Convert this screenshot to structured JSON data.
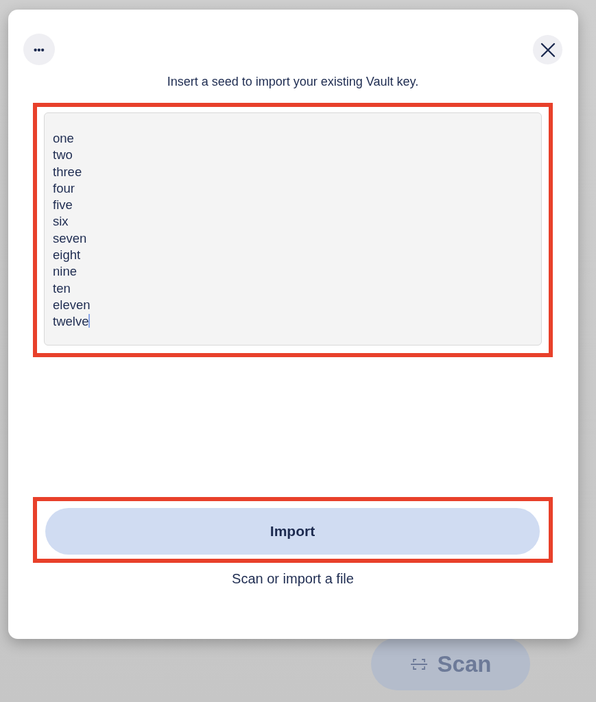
{
  "background": {
    "scan_button": {
      "label": "Scan",
      "disabled": true
    }
  },
  "dialog": {
    "more_button": {
      "label": "•••"
    },
    "instruction": "Insert a seed to import your existing Vault key.",
    "seed_field": {
      "value": "one\ntwo\nthree\nfour\nfive\nsix\nseven\neight\nnine\nten\neleven\ntwelve",
      "focused": true,
      "highlighted": true
    },
    "import_button": {
      "label": "Import",
      "highlighted": true
    },
    "scan_link": "Scan or import a file"
  }
}
